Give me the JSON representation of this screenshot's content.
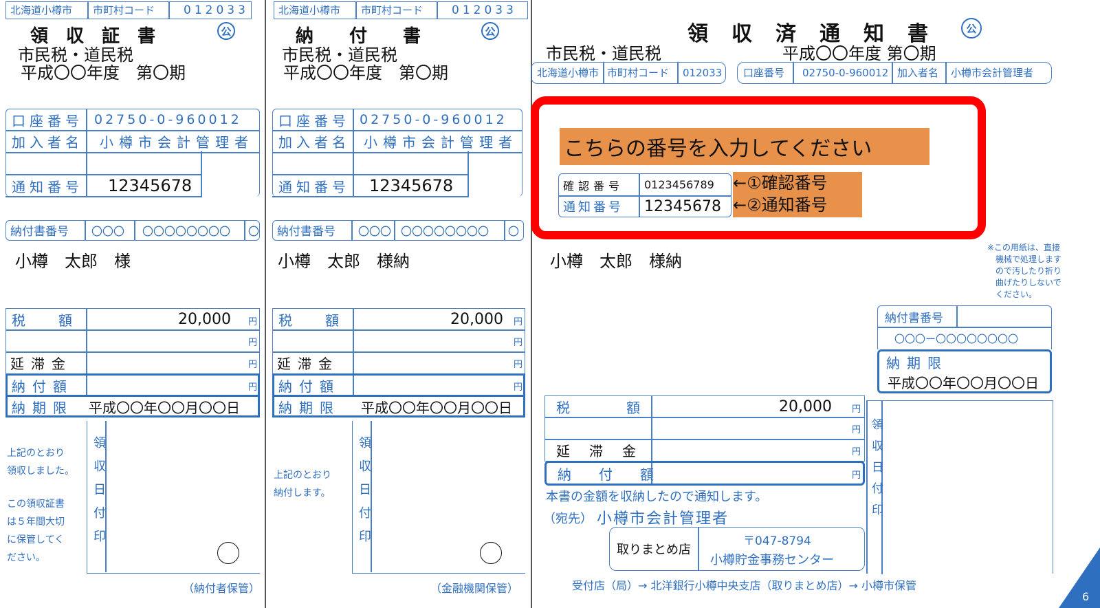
{
  "common": {
    "municipality": "北海道小樽市",
    "code_label": "市町村コード",
    "code": "012033",
    "tax_name": "市民税・道民税",
    "period": "平成〇〇年度　第〇期",
    "account_label": "口座番号",
    "account_number": "02750-0-960012",
    "member_label": "加入者名",
    "member_name": "小樽市会計管理者",
    "notice_label": "通知番号",
    "notice_number": "12345678",
    "form_label": "納付書番号",
    "form_part1": "〇〇〇",
    "form_part2": "〇〇〇〇〇〇〇〇",
    "form_part3": "〇",
    "kou": "公",
    "tax_amount_label": "税　額",
    "tax_amount": "20,000",
    "yen": "円",
    "late_fee_label": "延滞金",
    "paid_amount_label": "納付額",
    "due_label": "納期限",
    "due_date": "平成〇〇年〇〇月〇〇日",
    "stamp_label": "領収日付印"
  },
  "receipt": {
    "title": "領　収　証　書",
    "name": "小樽　太郎　様",
    "note": [
      "上記のとおり",
      "領収しました。",
      "",
      "この領収証書",
      "は５年間大切",
      "に保管してく",
      "ださい。"
    ],
    "keep": "（納付者保管）"
  },
  "payment": {
    "title": "納　　付　　書",
    "name": "小樽　太郎　様納",
    "note": [
      "上記のとおり",
      "納付します。"
    ],
    "keep": "（金融機関保管）"
  },
  "notice": {
    "title": "領　収　済　通　知　書",
    "tax_name": "市民税・道民税",
    "period": "平成〇〇年度 第〇期",
    "account_number": "02750-0-960012",
    "name": "小樽　太郎　様納",
    "confirm_label": "確認番号",
    "confirm_number": "0123456789",
    "highlight_text": "こちらの番号を入力してください",
    "arrow1": "←①確認番号",
    "arrow2": "←②通知番号",
    "caution": [
      "※この用紙は、直接",
      "機械で処理します",
      "ので汚したり折り",
      "曲げたりしないで",
      "ください。"
    ],
    "form_label": "納付書番号",
    "form_number": "〇〇〇ー〇〇〇〇〇〇〇〇",
    "due_label": "納期限",
    "due_date": "平成〇〇年〇〇月〇〇日",
    "tax_label": "税　　額",
    "late_label": "延　滞　金",
    "paid_label": "納　付　額",
    "statement": "本書の金額を収納したので通知します。",
    "addressee_label": "（宛先）",
    "addressee": "小樽市会計管理者",
    "collect_label": "取りまとめ店",
    "postal": "〒047-8794",
    "center": "小樽貯金事務センター",
    "route": "受付店（局）→ 北洋銀行小樽中央支店（取りまとめ店）→ 小樽市保管",
    "page": "6"
  },
  "colors": {
    "blue": "#2f6fc0",
    "red": "#ff0000",
    "orange": "#e8914a"
  }
}
